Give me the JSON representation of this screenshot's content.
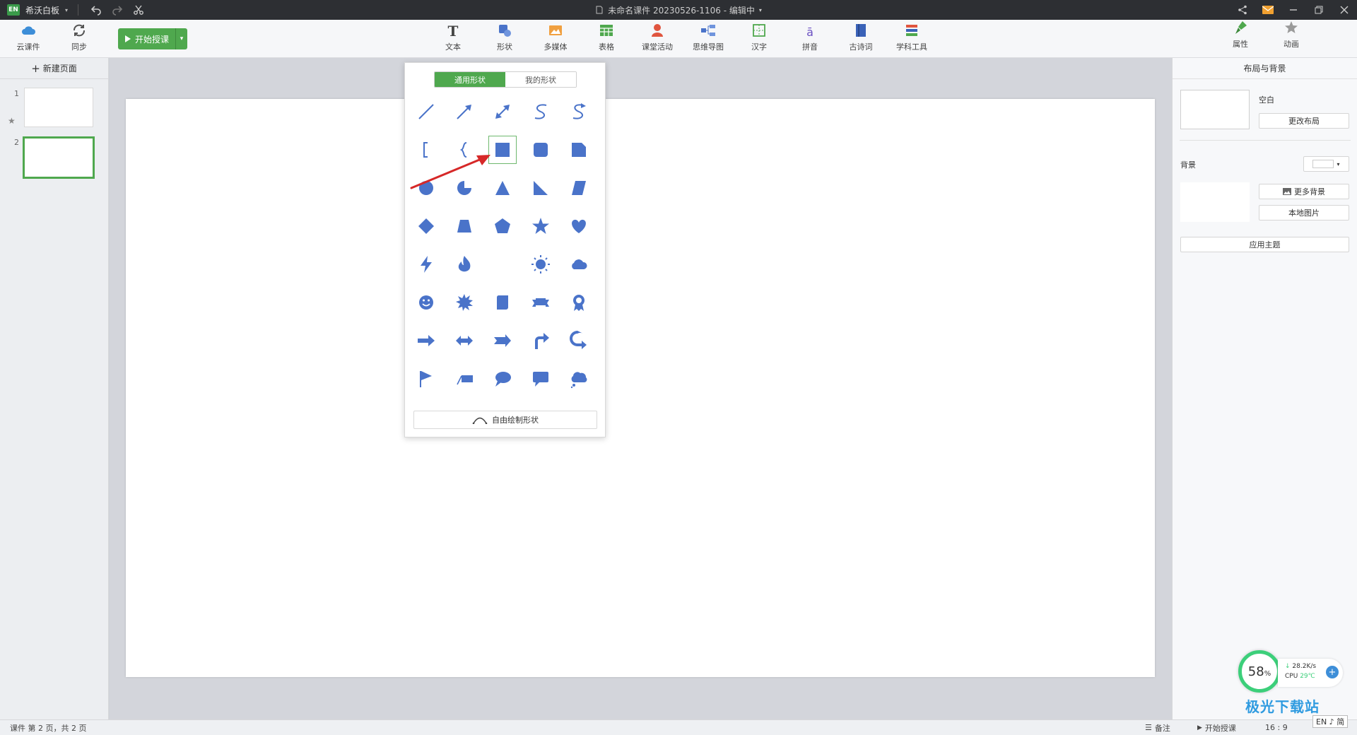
{
  "titlebar": {
    "logo_text": "EN",
    "app_name": "希沃白板",
    "doc_title": "未命名课件 20230526-1106 - 编辑中"
  },
  "toolbar": {
    "cloud_label": "云课件",
    "sync_label": "同步",
    "start_label": "开始授课",
    "tools": [
      {
        "label": "文本",
        "icon": "text-icon"
      },
      {
        "label": "形状",
        "icon": "shape-icon"
      },
      {
        "label": "多媒体",
        "icon": "media-icon"
      },
      {
        "label": "表格",
        "icon": "table-icon"
      },
      {
        "label": "课堂活动",
        "icon": "activity-icon"
      },
      {
        "label": "思维导图",
        "icon": "mindmap-icon"
      },
      {
        "label": "汉字",
        "icon": "hanzi-icon"
      },
      {
        "label": "拼音",
        "icon": "pinyin-icon"
      },
      {
        "label": "古诗词",
        "icon": "poem-icon"
      },
      {
        "label": "学科工具",
        "icon": "subject-tools-icon"
      }
    ],
    "properties_label": "属性",
    "animation_label": "动画"
  },
  "left_panel": {
    "new_page_label": "新建页面",
    "pages": [
      {
        "num": "1"
      },
      {
        "num": "2"
      }
    ]
  },
  "shape_popup": {
    "tab_common": "通用形状",
    "tab_mine": "我的形状",
    "free_draw_label": "自由绘制形状",
    "shapes": [
      "line-icon",
      "arrow-line-icon",
      "double-arrow-line-icon",
      "s-curve-icon",
      "s-curve-arrow-icon",
      "bracket-icon",
      "brace-icon",
      "square-icon",
      "rounded-square-icon",
      "snip-square-icon",
      "circle-icon",
      "pie-icon",
      "triangle-icon",
      "right-triangle-icon",
      "parallelogram-icon",
      "diamond-icon",
      "trapezoid-icon",
      "pentagon-icon",
      "star-icon",
      "heart-icon",
      "lightning-icon",
      "flame-icon",
      "moon-icon",
      "sun-icon",
      "cloud-icon",
      "smiley-icon",
      "burst-icon",
      "scroll-icon",
      "ribbon-icon",
      "badge-icon",
      "right-arrow-icon",
      "left-right-arrow-icon",
      "notched-arrow-icon",
      "turn-arrow-icon",
      "u-turn-arrow-icon",
      "flag-icon",
      "callout-line-icon",
      "oval-callout-icon",
      "rect-callout-icon",
      "cloud-callout-icon"
    ],
    "selected_index": 7
  },
  "right_panel": {
    "header": "布局与背景",
    "layout_name": "空白",
    "change_layout": "更改布局",
    "background_label": "背景",
    "more_background": "更多背景",
    "local_image": "本地图片",
    "apply_theme": "应用主题"
  },
  "statusbar": {
    "page_info": "课件 第 2 页，共 2 页",
    "notes": "备注",
    "start": "开始授课",
    "ratio": "16 : 9"
  },
  "net_widget": {
    "cpu_percent": "58",
    "percent_sign": "%",
    "speed": "28.2K/s",
    "cpu_label": "CPU",
    "temp": "29℃"
  },
  "watermark": "极光下载站",
  "ime": "EN ♪ 简",
  "colors": {
    "accent_green": "#4fa84e",
    "shape_blue": "#4a73c9",
    "arrow_red": "#d62828"
  }
}
